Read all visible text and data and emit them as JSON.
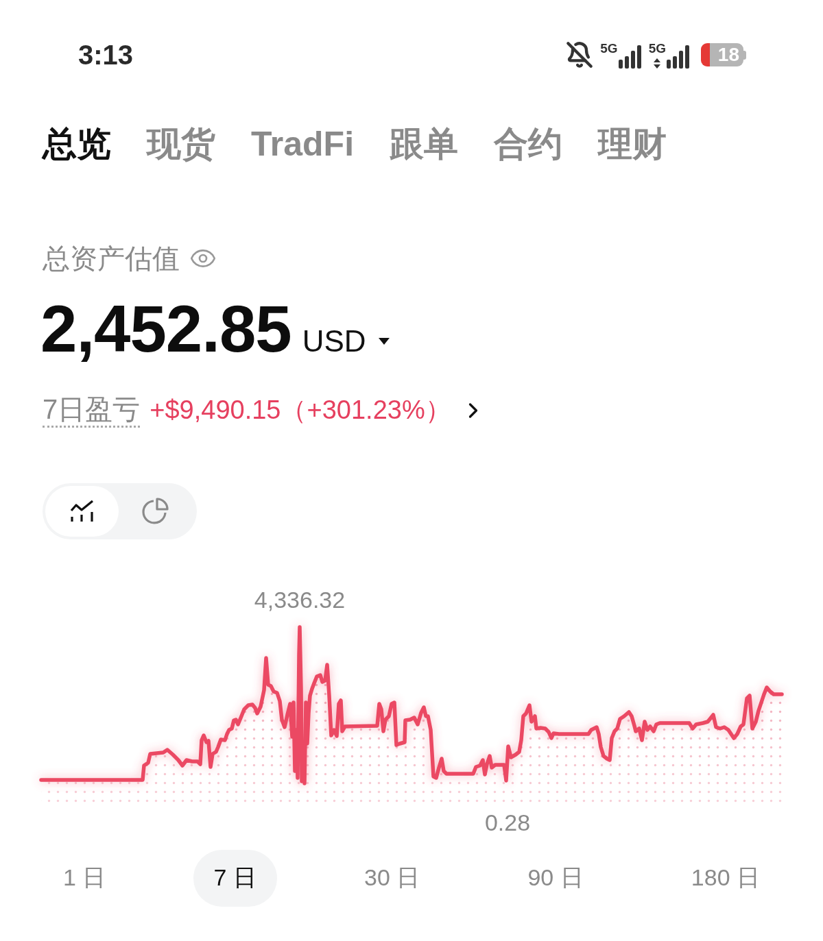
{
  "status_bar": {
    "time": "3:13",
    "networks": [
      {
        "label": "5G",
        "kind": "plain"
      },
      {
        "label": "5G",
        "kind": "data"
      }
    ],
    "battery": "18"
  },
  "tabs": [
    {
      "label": "总览",
      "selected": true
    },
    {
      "label": "现货",
      "selected": false
    },
    {
      "label": "TradFi",
      "selected": false
    },
    {
      "label": "跟单",
      "selected": false
    },
    {
      "label": "合约",
      "selected": false
    },
    {
      "label": "理财",
      "selected": false
    }
  ],
  "total_assets": {
    "label": "总资产估值",
    "amount": "2,452.85",
    "currency": "USD"
  },
  "pnl": {
    "label": "7日盈亏",
    "value": "+$9,490.15（+301.23%）"
  },
  "view_toggle": [
    {
      "kind": "line",
      "selected": true
    },
    {
      "kind": "pie",
      "selected": false
    }
  ],
  "chart": {
    "max_label": "4,336.32",
    "min_label": "0.28"
  },
  "periods": [
    {
      "label": "1 日",
      "selected": false
    },
    {
      "label": "7 日",
      "selected": true
    },
    {
      "label": "30 日",
      "selected": false
    },
    {
      "label": "90 日",
      "selected": false
    },
    {
      "label": "180 日",
      "selected": false
    }
  ]
}
